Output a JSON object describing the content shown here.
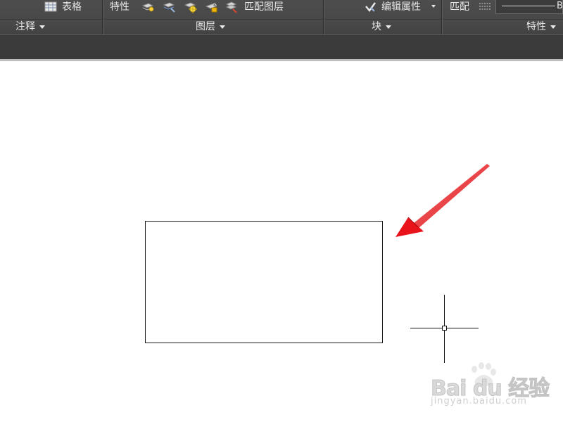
{
  "ribbon": {
    "annotation": {
      "table_label": "表格",
      "title": "注释"
    },
    "layers": {
      "properties_label": "特性",
      "match_layer_label": "匹配图层",
      "title": "图层"
    },
    "block": {
      "edit_attributes_label": "编辑属性",
      "title": "块"
    },
    "properties": {
      "match_label": "匹配",
      "lineweight_value": "B",
      "title": "特性"
    }
  },
  "watermark": {
    "main": "Bai du 经验",
    "sub": "jingyan.baidu.com"
  },
  "colors": {
    "ribbon_bg": "#474747",
    "strip_bg": "#3b3b3b",
    "canvas_bg": "#ffffff",
    "arrow": "#e8131b",
    "text": "#e8e8e8"
  },
  "icons": [
    "table-icon",
    "layer-on-icon",
    "layer-isolate-icon",
    "layer-freeze-icon",
    "layer-lock-icon",
    "layer-match-icon",
    "edit-attributes-icon",
    "linetype-icon"
  ]
}
